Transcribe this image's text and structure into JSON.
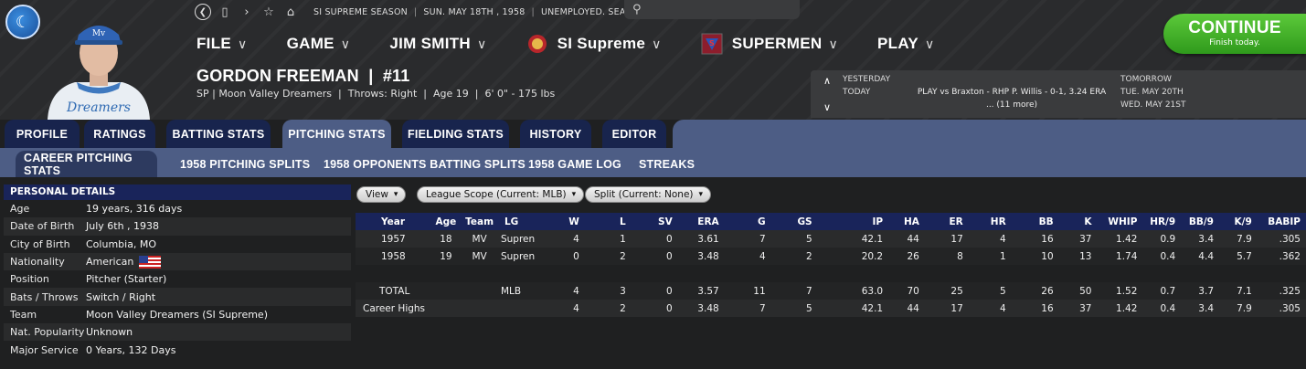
{
  "topbar": {
    "season": "SI SUPREME SEASON",
    "date": "SUN. MAY 18TH , 1958",
    "status": "UNEMPLOYED. SEARCH JOBS..."
  },
  "menu": {
    "file": "FILE",
    "game": "GAME",
    "manager": "JIM SMITH",
    "league": "SI Supreme",
    "team": "SUPERMEN",
    "play": "PLAY"
  },
  "player": {
    "name": "GORDON FREEMAN  |  #11",
    "info": "SP | Moon Valley Dreamers  |  Throws: Right  |  Age 19  |  6' 0\" - 175 lbs",
    "jersey_text": "Dreamers"
  },
  "schedule": {
    "yesterday": "YESTERDAY",
    "today": "TODAY",
    "today_game": "PLAY vs Braxton - RHP P. Willis - 0-1, 3.24 ERA",
    "more": "... (11 more)",
    "tomorrow": "TOMORROW",
    "tue": "TUE. MAY 20TH",
    "wed": "WED. MAY 21ST"
  },
  "continue": {
    "label": "CONTINUE",
    "sub": "Finish today."
  },
  "tabs": [
    "PROFILE",
    "RATINGS",
    "BATTING STATS",
    "PITCHING STATS",
    "FIELDING STATS",
    "HISTORY",
    "EDITOR"
  ],
  "subtabs": [
    "CAREER PITCHING STATS",
    "1958 PITCHING SPLITS",
    "1958 OPPONENTS BATTING SPLITS",
    "1958 GAME LOG",
    "STREAKS"
  ],
  "personal": {
    "header": "PERSONAL DETAILS",
    "rows": [
      {
        "k": "Age",
        "v": "19 years, 316 days"
      },
      {
        "k": "Date of Birth",
        "v": "July 6th , 1938"
      },
      {
        "k": "City of Birth",
        "v": "Columbia, MO"
      },
      {
        "k": "Nationality",
        "v": "American"
      },
      {
        "k": "Position",
        "v": "Pitcher (Starter)"
      },
      {
        "k": "Bats / Throws",
        "v": "Switch / Right"
      },
      {
        "k": "Team",
        "v": "Moon Valley Dreamers (SI Supreme)"
      },
      {
        "k": "Nat. Popularity",
        "v": "Unknown"
      },
      {
        "k": "Major Service",
        "v": "0 Years, 132 Days"
      }
    ]
  },
  "filters": {
    "view": "View",
    "scope": "League Scope (Current: MLB)",
    "split": "Split (Current: None)"
  },
  "stats": {
    "columns": [
      "Year",
      "Age",
      "Team",
      "LG",
      "W",
      "L",
      "SV",
      "ERA",
      "G",
      "GS",
      "IP",
      "HA",
      "ER",
      "HR",
      "BB",
      "K",
      "WHIP",
      "HR/9",
      "BB/9",
      "K/9",
      "BABIP"
    ],
    "rows": [
      [
        "1957",
        "18",
        "MV",
        "Supren",
        "4",
        "1",
        "0",
        "3.61",
        "7",
        "5",
        "42.1",
        "44",
        "17",
        "4",
        "16",
        "37",
        "1.42",
        "0.9",
        "3.4",
        "7.9",
        ".305"
      ],
      [
        "1958",
        "19",
        "MV",
        "Supren",
        "0",
        "2",
        "0",
        "3.48",
        "4",
        "2",
        "20.2",
        "26",
        "8",
        "1",
        "10",
        "13",
        "1.74",
        "0.4",
        "4.4",
        "5.7",
        ".362"
      ],
      [
        "",
        "",
        "",
        "",
        "",
        "",
        "",
        "",
        "",
        "",
        "",
        "",
        "",
        "",
        "",
        "",
        "",
        "",
        "",
        "",
        ""
      ],
      [
        "TOTAL",
        "",
        "",
        "MLB",
        "4",
        "3",
        "0",
        "3.57",
        "11",
        "7",
        "63.0",
        "70",
        "25",
        "5",
        "26",
        "50",
        "1.52",
        "0.7",
        "3.7",
        "7.1",
        ".325"
      ],
      [
        "Career Highs",
        "",
        "",
        "",
        "4",
        "2",
        "0",
        "3.48",
        "7",
        "5",
        "42.1",
        "44",
        "17",
        "4",
        "16",
        "37",
        "1.42",
        "0.4",
        "3.4",
        "7.9",
        ".305"
      ]
    ]
  },
  "colors": {
    "accent": "#4d5d85",
    "tab": "#18244d",
    "header": "#19245a",
    "continue": "#3fae28"
  }
}
